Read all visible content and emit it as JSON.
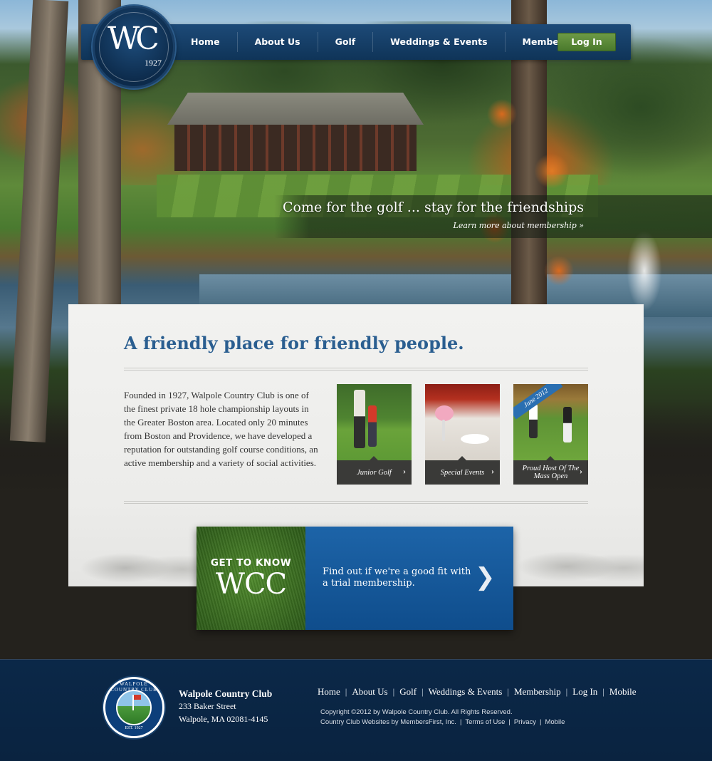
{
  "brand": {
    "logo_monogram": "WC",
    "logo_monogram_c": "C",
    "logo_year": "1927",
    "seal_text": "WALPOLE COUNTRY CLUB",
    "seal_est": "EST. 1927"
  },
  "nav": {
    "items": [
      {
        "label": "Home"
      },
      {
        "label": "About Us"
      },
      {
        "label": "Golf"
      },
      {
        "label": "Weddings & Events"
      },
      {
        "label": "Membership"
      }
    ],
    "login_label": "Log In"
  },
  "hero": {
    "title": "Come for the golf ... stay for the friendships",
    "link": "Learn more about membership »"
  },
  "content": {
    "heading": "A friendly place for friendly people.",
    "intro": "Founded in 1927, Walpole Country Club is one of the finest private 18 hole championship layouts in the Greater Boston area. Located only 20 minutes from Boston and Providence, we have developed a reputation for outstanding golf course conditions, an active membership and a variety of social activities.",
    "tiles": [
      {
        "caption": "Junior Golf"
      },
      {
        "caption": "Special Events"
      },
      {
        "caption": "Proud Host Of The Mass Open",
        "ribbon": "June 2012"
      }
    ]
  },
  "cta": {
    "kicker": "GET TO KNOW",
    "big": "WCC",
    "text": "Find out if we're a good fit with a trial membership."
  },
  "footer": {
    "name": "Walpole Country Club",
    "address_line1": "233 Baker Street",
    "address_line2": "Walpole, MA 02081-4145",
    "nav": [
      "Home",
      "About Us",
      "Golf",
      "Weddings & Events",
      "Membership",
      "Log In",
      "Mobile"
    ],
    "copyright": "Copyright ©2012 by Walpole Country Club. All Rights Reserved.",
    "credits": [
      "Country Club Websites by MembersFirst, Inc.",
      "Terms of Use",
      "Privacy",
      "Mobile"
    ]
  },
  "colors": {
    "nav_blue": "#0f3458",
    "accent_blue": "#2a5e90",
    "login_green": "#5a8a38",
    "cta_blue": "#1d64a8",
    "footer_navy": "#0b2848"
  }
}
